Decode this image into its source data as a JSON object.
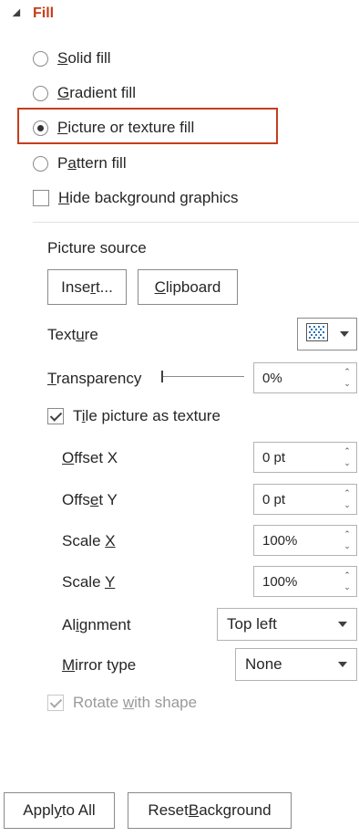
{
  "fill": {
    "title": "Fill",
    "options": [
      {
        "pre": "",
        "ul": "S",
        "post": "olid fill",
        "selected": false
      },
      {
        "pre": "",
        "ul": "G",
        "post": "radient fill",
        "selected": false
      },
      {
        "pre": "",
        "ul": "P",
        "post": "icture or texture fill",
        "selected": true
      },
      {
        "pre": "P",
        "ul": "a",
        "post": "ttern fill",
        "selected": false
      }
    ],
    "hide_bg": {
      "pre": "",
      "ul": "H",
      "post": "ide background graphics",
      "checked": false
    }
  },
  "picture_source": {
    "label": "Picture source",
    "insert": {
      "pre": "Inse",
      "ul": "r",
      "post": "t..."
    },
    "clipboard": {
      "pre": "",
      "ul": "C",
      "post": "lipboard"
    }
  },
  "texture": {
    "pre": "Text",
    "ul": "u",
    "post": "re",
    "icon": "texture-swatch-icon"
  },
  "transparency": {
    "pre": "",
    "ul": "T",
    "post": "ransparency",
    "value": "0%",
    "level": 0
  },
  "tile": {
    "pre": "T",
    "ul": "i",
    "post": "le picture as texture",
    "checked": true
  },
  "offset_x": {
    "pre": "",
    "ul": "O",
    "post": "ffset X",
    "value": "0 pt"
  },
  "offset_y": {
    "pre": "Offs",
    "ul": "e",
    "post": "t Y",
    "value": "0 pt"
  },
  "scale_x": {
    "pre": "Scale ",
    "ul": "X",
    "post": "",
    "value": "100%"
  },
  "scale_y": {
    "pre": "Scale ",
    "ul": "Y",
    "post": "",
    "value": "100%"
  },
  "alignment": {
    "pre": "Al",
    "ul": "i",
    "post": "gnment",
    "value": "Top left"
  },
  "mirror": {
    "pre": "",
    "ul": "M",
    "post": "irror type",
    "value": "None"
  },
  "rotate": {
    "pre": "Rotate ",
    "ul": "w",
    "post": "ith shape",
    "checked": true,
    "disabled": true
  },
  "footer": {
    "apply": {
      "pre": "Appl",
      "ul": "y",
      "post": " to All"
    },
    "reset": {
      "pre": "Reset ",
      "ul": "B",
      "post": "ackground"
    }
  },
  "colors": {
    "accent": "#c43e1c",
    "text": "#262626",
    "disabled": "#9a9a9a"
  }
}
